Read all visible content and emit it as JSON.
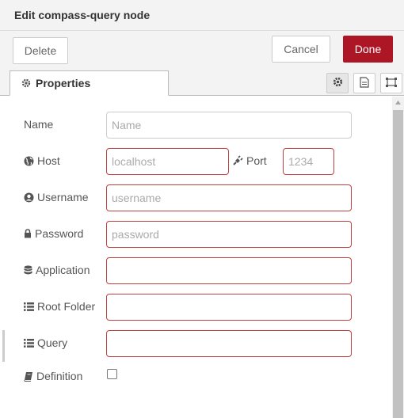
{
  "dialog": {
    "title": "Edit compass-query node"
  },
  "toolbar": {
    "delete_label": "Delete",
    "cancel_label": "Cancel",
    "done_label": "Done"
  },
  "tabs": [
    {
      "label": "Properties",
      "icon": "gear-icon"
    }
  ],
  "tab_icons": [
    "gear-icon",
    "document-icon",
    "frame-icon"
  ],
  "fields": {
    "name": {
      "label": "Name",
      "placeholder": "Name",
      "value": ""
    },
    "host": {
      "label": "Host",
      "icon": "globe-icon",
      "placeholder": "localhost",
      "value": ""
    },
    "port": {
      "label": "Port",
      "icon": "plug-icon",
      "placeholder": "1234",
      "value": ""
    },
    "username": {
      "label": "Username",
      "icon": "user-circle-icon",
      "placeholder": "username",
      "value": ""
    },
    "password": {
      "label": "Password",
      "icon": "lock-icon",
      "placeholder": "password",
      "value": ""
    },
    "application": {
      "label": "Application",
      "icon": "database-icon",
      "value": ""
    },
    "root_folder": {
      "label": "Root Folder",
      "icon": "list-icon",
      "value": ""
    },
    "query": {
      "label": "Query",
      "icon": "list-icon",
      "value": ""
    },
    "definition": {
      "label": "Definition",
      "icon": "book-icon",
      "checked": false
    }
  },
  "colors": {
    "accent": "#ad1625",
    "error_border": "#c04040",
    "panel_bg": "#f3f3f3"
  }
}
